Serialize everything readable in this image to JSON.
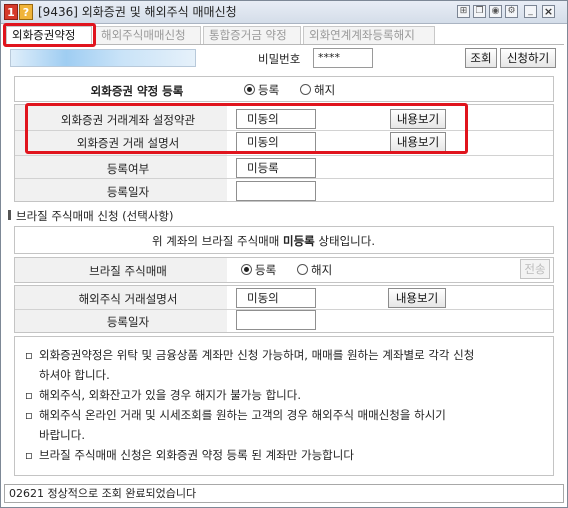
{
  "window": {
    "title": "[9436] 외화증권 및 해외주식 매매신청",
    "badge_num": "1",
    "badge_q": "?"
  },
  "tabs": [
    {
      "label": "외화증권약정",
      "active": true
    },
    {
      "label": "해외주식매매신청",
      "active": false
    },
    {
      "label": "통합증거금 약정",
      "active": false
    },
    {
      "label": "외화연계계좌등록해지",
      "active": false
    }
  ],
  "account": {
    "password_label": "비밀번호",
    "password_value": "****",
    "query_button": "조회",
    "apply_button": "신청하기"
  },
  "agreement": {
    "title": "외화증권 약정 등록",
    "radio_register": "등록",
    "radio_cancel": "해지",
    "selected": "register",
    "rows": [
      {
        "label": "외화증권 거래계좌 설정약관",
        "value": "미동의",
        "button": "내용보기"
      },
      {
        "label": "외화증권 거래 설명서",
        "value": "미동의",
        "button": "내용보기"
      }
    ],
    "registered_label": "등록여부",
    "registered_value": "미등록",
    "reg_date_label": "등록일자",
    "reg_date_value": ""
  },
  "brazil": {
    "section_title": "브라질 주식매매 신청 (선택사항)",
    "status_prefix": "위 계좌의 브라질 주식매매",
    "status_value": "미등록",
    "status_suffix": "상태입니다.",
    "trade_label": "브라질 주식매매",
    "radio_register": "등록",
    "radio_cancel": "해지",
    "send_button": "전송",
    "manual_label": "해외주식 거래설명서",
    "manual_value": "미동의",
    "manual_button": "내용보기",
    "reg_date_label": "등록일자",
    "reg_date_value": ""
  },
  "notes": [
    {
      "bullet": "▫",
      "lines": [
        "외화증권약정은 위탁 및 금융상품 계좌만 신청 가능하며, 매매를 원하는 계좌별로 각각 신청",
        "하셔야 합니다."
      ]
    },
    {
      "bullet": "▫",
      "lines": [
        "해외주식, 외화잔고가 있을 경우 해지가 불가능 합니다."
      ]
    },
    {
      "bullet": "▫",
      "lines": [
        "해외주식 온라인 거래 및 시세조회를 원하는 고객의 경우 해외주식 매매신청을 하시기",
        "바랍니다."
      ]
    },
    {
      "bullet": "▫",
      "lines": [
        "브라질 주식매매 신청은 외화증권 약정 등록 된 계좌만 가능합니다"
      ]
    }
  ],
  "statusbar": {
    "message": "02621 정상적으로 조회 완료되었습니다"
  },
  "colors": {
    "highlight": "#e0141d",
    "badge_red": "#d63a2a",
    "badge_orange": "#f0b43a"
  }
}
